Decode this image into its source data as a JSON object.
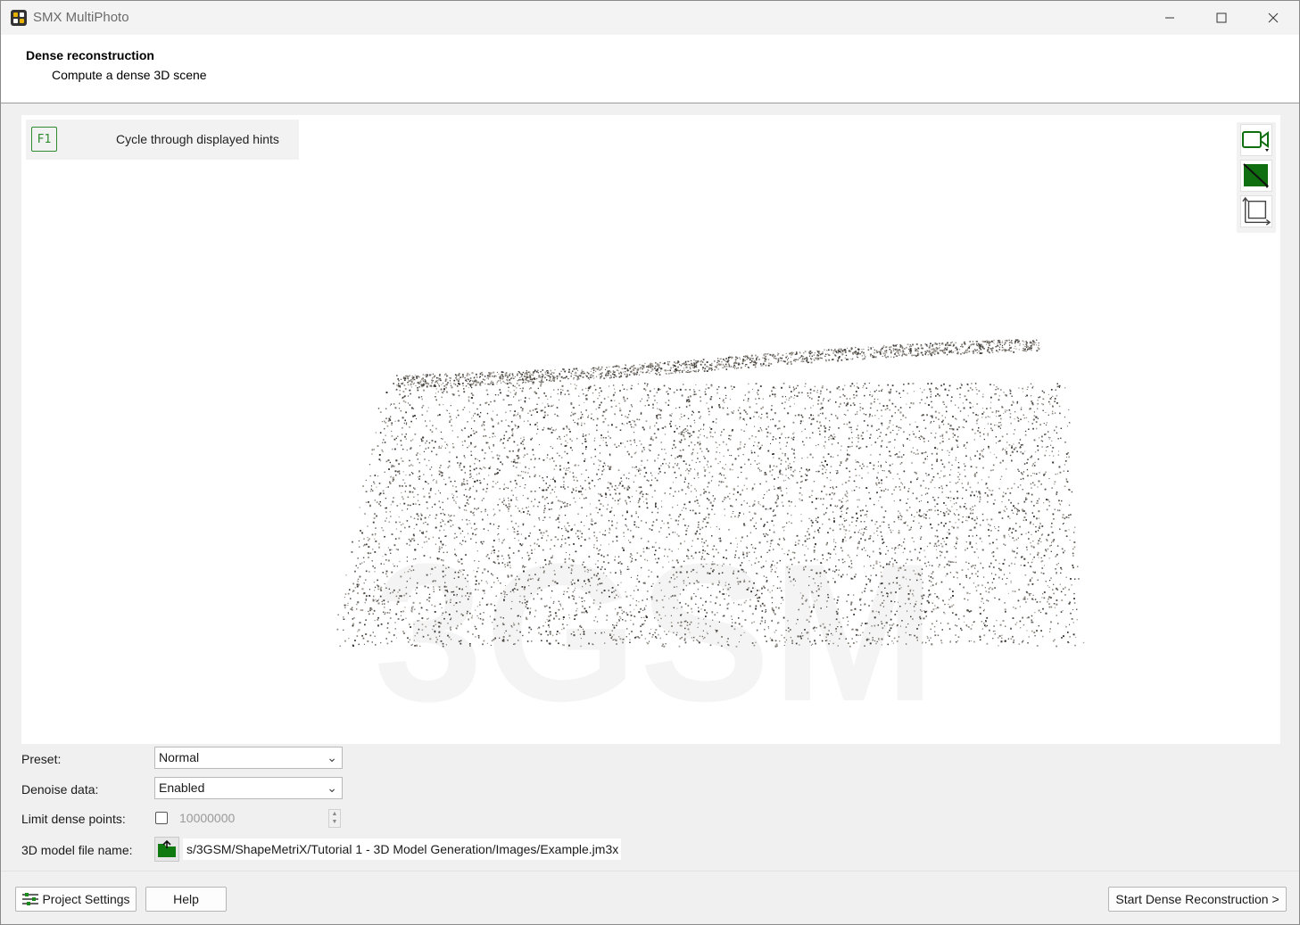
{
  "window": {
    "title": "SMX MultiPhoto",
    "icon": "smx-app-icon",
    "controls": [
      "minimize-icon",
      "maximize-icon",
      "close-icon"
    ]
  },
  "header": {
    "title": "Dense reconstruction",
    "subtitle": "Compute a dense 3D scene"
  },
  "viewport": {
    "hint_key": "F1",
    "hint_text": "Cycle through displayed hints",
    "watermark": "3GSM",
    "tools": [
      "video-camera-icon",
      "shading-mode-icon",
      "view-frame-icon"
    ],
    "accent_color": "#2e8b2e",
    "tool_fill_color": "#0f6e0f"
  },
  "form": {
    "preset": {
      "label": "Preset:",
      "value": "Normal"
    },
    "denoise": {
      "label": "Denoise data:",
      "value": "Enabled"
    },
    "limit": {
      "label": "Limit dense points:",
      "checked": false,
      "value": "10000000"
    },
    "file": {
      "label": "3D model file name:",
      "value": "s/3GSM/ShapeMetriX/Tutorial 1 - 3D Model Generation/Images/Example.jm3x",
      "icon": "open-folder-icon"
    }
  },
  "footer": {
    "project_settings": "Project Settings",
    "help": "Help",
    "start": "Start Dense Reconstruction >"
  }
}
